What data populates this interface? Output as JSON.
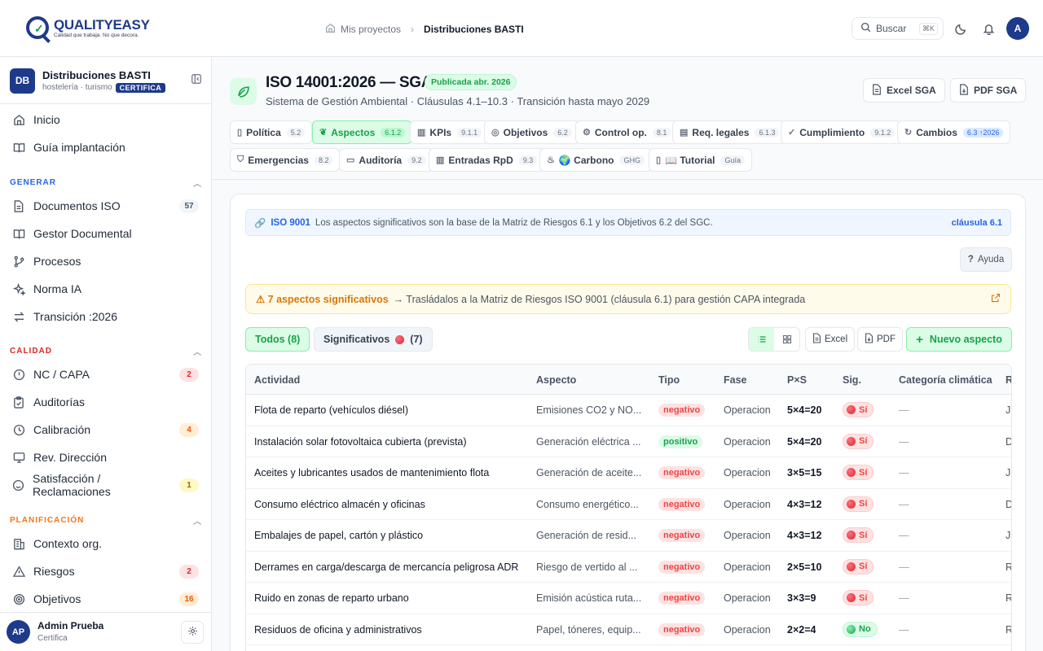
{
  "brand": {
    "name_a": "QUALITY",
    "name_b": "EASY",
    "tagline": "Calidad que trabaja. No que decora."
  },
  "breadcrumb": {
    "parent": "Mis proyectos",
    "current": "Distribuciones BASTI"
  },
  "search": {
    "label": "Buscar",
    "shortcut": "⌘K"
  },
  "user_initial": "A",
  "org": {
    "badge": "DB",
    "name": "Distribuciones BASTI",
    "sector": "hostelería · turismo",
    "plan": "CERTIFICA"
  },
  "nav": {
    "top": [
      {
        "label": "Inicio",
        "icon": "home-icon"
      },
      {
        "label": "Guía implantación",
        "icon": "book-icon"
      }
    ],
    "generar_title": "GENERAR",
    "generar": [
      {
        "label": "Documentos ISO",
        "count": "57"
      },
      {
        "label": "Gestor Documental",
        "count": ""
      },
      {
        "label": "Procesos",
        "count": ""
      },
      {
        "label": "Norma IA",
        "count": ""
      },
      {
        "label": "Transición :2026",
        "count": ""
      }
    ],
    "calidad_title": "CALIDAD",
    "calidad": [
      {
        "label": "NC / CAPA",
        "count": "2"
      },
      {
        "label": "Auditorías",
        "count": ""
      },
      {
        "label": "Calibración",
        "count": "4"
      },
      {
        "label": "Rev. Dirección",
        "count": ""
      },
      {
        "label": "Satisfacción / Reclamaciones",
        "count": "1"
      }
    ],
    "plan_title": "PLANIFICACIÓN",
    "plan": [
      {
        "label": "Contexto org.",
        "count": ""
      },
      {
        "label": "Riesgos",
        "count": "2"
      },
      {
        "label": "Objetivos",
        "count": "16"
      }
    ]
  },
  "user": {
    "initials": "AP",
    "name": "Admin Prueba",
    "role": "Certifica"
  },
  "header": {
    "title": "ISO 14001:2026 — SGA",
    "badge": "Publicada abr. 2026",
    "subtitle": "Sistema de Gestión Ambiental · Cláusulas 4.1–10.3 · Transición hasta mayo 2029",
    "btn_excel": "Excel SGA",
    "btn_pdf": "PDF SGA"
  },
  "tabs": [
    {
      "label": "Política",
      "clause": "5.2"
    },
    {
      "label": "Aspectos",
      "clause": "6.1.2"
    },
    {
      "label": "KPIs",
      "clause": "9.1.1"
    },
    {
      "label": "Objetivos",
      "clause": "6.2"
    },
    {
      "label": "Control op.",
      "clause": "8.1"
    },
    {
      "label": "Req. legales",
      "clause": "6.1.3"
    },
    {
      "label": "Cumplimiento",
      "clause": "9.1.2"
    },
    {
      "label": "Cambios",
      "clause": "6.3 ↑2026"
    },
    {
      "label": "Emergencias",
      "clause": "8.2"
    },
    {
      "label": "Auditoría",
      "clause": "9.2"
    },
    {
      "label": "Entradas RpD",
      "clause": "9.3"
    },
    {
      "label": "🌍 Carbono",
      "clause": "GHG"
    },
    {
      "label": "📖 Tutorial",
      "clause": "Guía"
    }
  ],
  "iso_note": {
    "tag": "ISO 9001",
    "text": "Los aspectos significativos son la base de la Matriz de Riesgos 6.1 y los Objetivos 6.2 del SGC.",
    "link": "cláusula 6.1"
  },
  "help_label": "Ayuda",
  "warning": {
    "strong": "⚠ 7 aspectos significativos",
    "text": "→ Trasládalos a la Matriz de Riesgos ISO 9001 (cláusula 6.1) para gestión CAPA integrada"
  },
  "filters": {
    "all": "Todos (8)",
    "sig": "Significativos",
    "sig_count": "(7)"
  },
  "toolbar": {
    "excel": "Excel",
    "pdf": "PDF",
    "new": "Nuevo aspecto"
  },
  "table": {
    "headers": [
      "Actividad",
      "Aspecto",
      "Tipo",
      "Fase",
      "P×S",
      "Sig.",
      "Categoría climática",
      "R"
    ],
    "rows": [
      {
        "actividad": "Flota de reparto (vehículos diésel)",
        "aspecto": "Emisiones CO2 y NO...",
        "tipo": "negativo",
        "fase": "Operacion",
        "pxs": "5×4=20",
        "sig": "Sí",
        "cat": "—",
        "r": "J"
      },
      {
        "actividad": "Instalación solar fotovoltaica cubierta (prevista)",
        "aspecto": "Generación eléctrica ...",
        "tipo": "positivo",
        "fase": "Operacion",
        "pxs": "5×4=20",
        "sig": "Sí",
        "cat": "—",
        "r": "D"
      },
      {
        "actividad": "Aceites y lubricantes usados de mantenimiento flota",
        "aspecto": "Generación de aceite...",
        "tipo": "negativo",
        "fase": "Operacion",
        "pxs": "3×5=15",
        "sig": "Sí",
        "cat": "—",
        "r": "J"
      },
      {
        "actividad": "Consumo eléctrico almacén y oficinas",
        "aspecto": "Consumo energético...",
        "tipo": "negativo",
        "fase": "Operacion",
        "pxs": "4×3=12",
        "sig": "Sí",
        "cat": "—",
        "r": "D"
      },
      {
        "actividad": "Embalajes de papel, cartón y plástico",
        "aspecto": "Generación de resid...",
        "tipo": "negativo",
        "fase": "Operacion",
        "pxs": "4×3=12",
        "sig": "Sí",
        "cat": "—",
        "r": "J"
      },
      {
        "actividad": "Derrames en carga/descarga de mercancía peligrosa ADR",
        "aspecto": "Riesgo de vertido al ...",
        "tipo": "negativo",
        "fase": "Operacion",
        "pxs": "2×5=10",
        "sig": "Sí",
        "cat": "—",
        "r": "R"
      },
      {
        "actividad": "Ruido en zonas de reparto urbano",
        "aspecto": "Emisión acústica ruta...",
        "tipo": "negativo",
        "fase": "Operacion",
        "pxs": "3×3=9",
        "sig": "Sí",
        "cat": "—",
        "r": "R"
      },
      {
        "actividad": "Residuos de oficina y administrativos",
        "aspecto": "Papel, tóneres, equip...",
        "tipo": "negativo",
        "fase": "Operacion",
        "pxs": "2×2=4",
        "sig": "No",
        "cat": "—",
        "r": "R"
      }
    ]
  }
}
